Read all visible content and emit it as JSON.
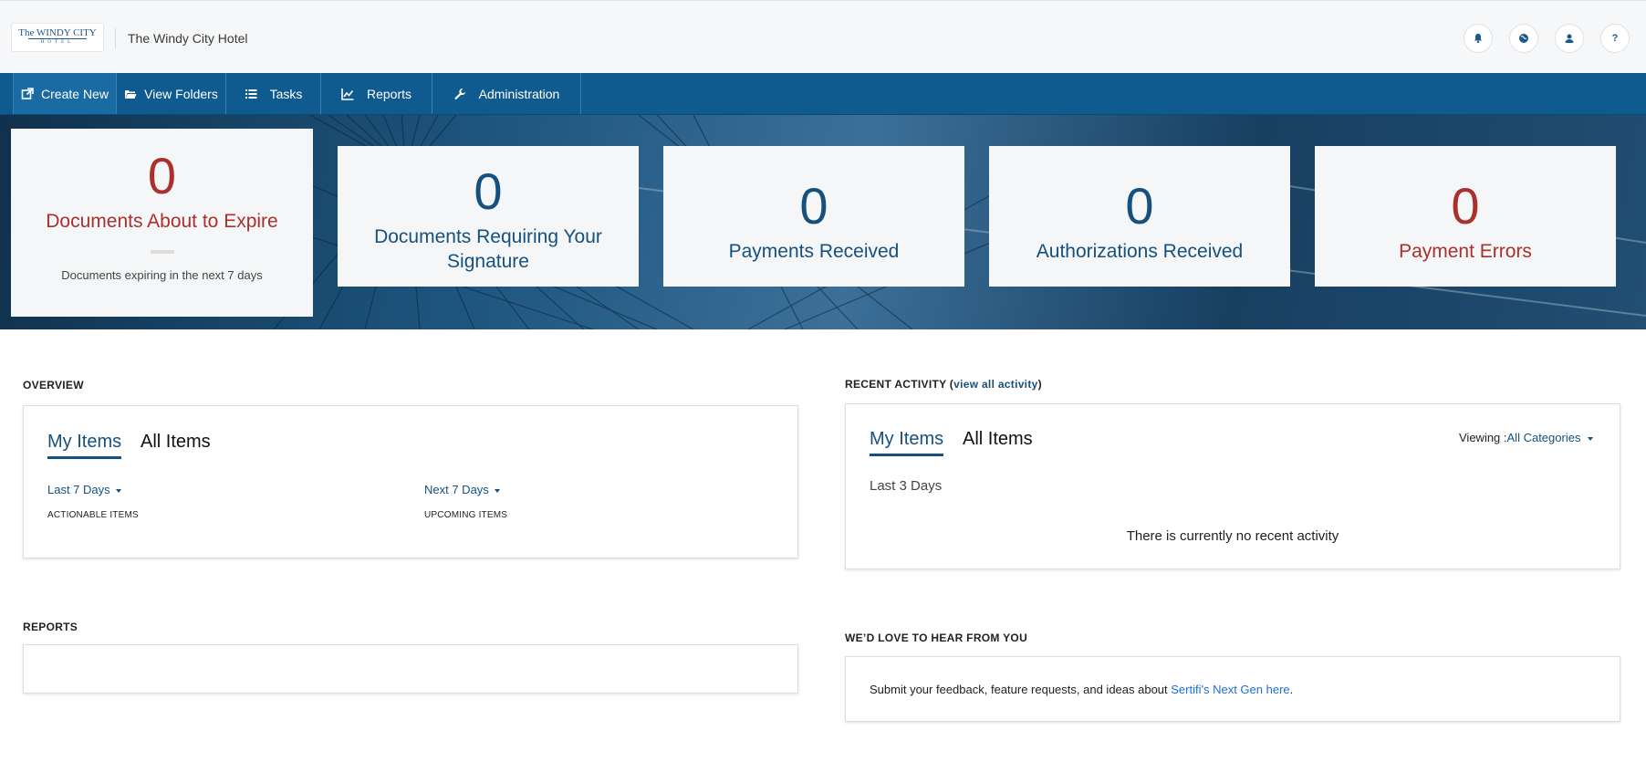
{
  "header": {
    "logo_line1": "The WINDY CITY",
    "logo_line2": "HOTEL",
    "hotel_name": "The Windy City Hotel",
    "help_label": "?"
  },
  "nav": {
    "items": [
      {
        "label": "Create New",
        "icon": "external-link-icon"
      },
      {
        "label": "View Folders",
        "icon": "folder-open-icon"
      },
      {
        "label": "Tasks",
        "icon": "list-icon"
      },
      {
        "label": "Reports",
        "icon": "line-chart-icon"
      },
      {
        "label": "Administration",
        "icon": "wrench-icon"
      }
    ]
  },
  "cards": [
    {
      "value": "0",
      "label": "Documents About to Expire",
      "sub": "Documents expiring in the next 7 days",
      "color": "#a9302c"
    },
    {
      "value": "0",
      "label": "Documents Requiring Your Signature",
      "color": "#15507f"
    },
    {
      "value": "0",
      "label": "Payments Received",
      "color": "#15507f"
    },
    {
      "value": "0",
      "label": "Authorizations Received",
      "color": "#15507f"
    },
    {
      "value": "0",
      "label": "Payment Errors",
      "color": "#a9302c"
    }
  ],
  "overview": {
    "title": "OVERVIEW",
    "tabs": [
      "My Items",
      "All Items"
    ],
    "left_filter": "Last 7 Days",
    "left_caption": "ACTIONABLE ITEMS",
    "right_filter": "Next 7 Days",
    "right_caption": "UPCOMING ITEMS"
  },
  "recent": {
    "title_prefix": "RECENT ACTIVITY (",
    "title_link": "view all activity",
    "title_suffix": ")",
    "tabs": [
      "My Items",
      "All Items"
    ],
    "viewing_label": "Viewing :",
    "viewing_value": "All Categories",
    "period": "Last 3 Days",
    "empty_message": "There is currently no recent activity"
  },
  "reports": {
    "title": "REPORTS"
  },
  "feedback": {
    "title": "WE’D LOVE TO HEAR FROM YOU",
    "text": "Submit your feedback, feature requests, and ideas about ",
    "link": "Sertifi's Next Gen here",
    "end": "."
  },
  "colors": {
    "primary": "#0f5a8f",
    "accent_blue": "#15507f",
    "alert_red": "#a9302c",
    "link_blue": "#1b6fd1"
  }
}
